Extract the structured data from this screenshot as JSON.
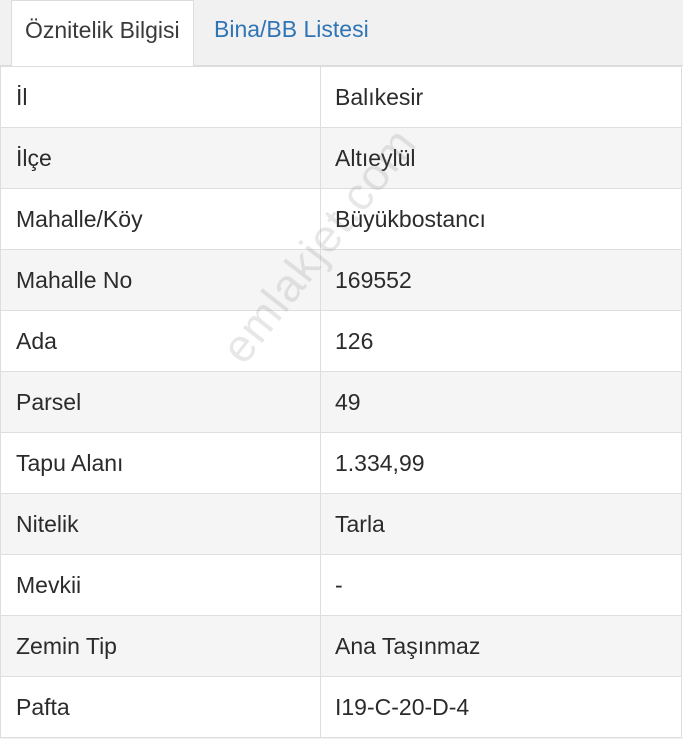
{
  "tabs": [
    {
      "label": "Öznitelik Bilgisi",
      "active": true
    },
    {
      "label": "Bina/BB Listesi",
      "active": false
    }
  ],
  "rows": [
    {
      "key": "İl",
      "value": "Balıkesir"
    },
    {
      "key": "İlçe",
      "value": "Altıeylül"
    },
    {
      "key": "Mahalle/Köy",
      "value": "Büyükbostancı"
    },
    {
      "key": "Mahalle No",
      "value": "169552"
    },
    {
      "key": "Ada",
      "value": "126"
    },
    {
      "key": "Parsel",
      "value": "49"
    },
    {
      "key": "Tapu Alanı",
      "value": "1.334,99"
    },
    {
      "key": "Nitelik",
      "value": "Tarla"
    },
    {
      "key": "Mevkii",
      "value": "-"
    },
    {
      "key": "Zemin Tip",
      "value": "Ana Taşınmaz"
    },
    {
      "key": "Pafta",
      "value": "I19-C-20-D-4"
    }
  ],
  "watermark": "emlakjet.com",
  "colors": {
    "tab_link": "#2f74b5",
    "row_alt": "#f5f5f5",
    "border": "#dedede"
  }
}
